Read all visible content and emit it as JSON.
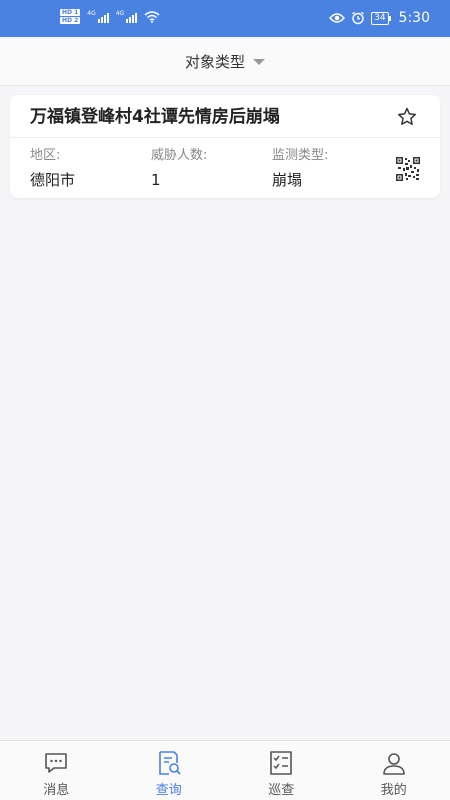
{
  "status_bar": {
    "hd1": "HD 1",
    "hd2": "HD 2",
    "net1": "4G",
    "net2": "4G",
    "battery": "34",
    "time": "5:30"
  },
  "filter": {
    "label": "对象类型"
  },
  "card": {
    "title": "万福镇登峰村4社谭先情房后崩塌",
    "fields": [
      {
        "label": "地区:",
        "value": "德阳市"
      },
      {
        "label": "威胁人数:",
        "value": "1"
      },
      {
        "label": "监测类型:",
        "value": "崩塌"
      }
    ]
  },
  "nav": {
    "items": [
      {
        "label": "消息",
        "icon": "message-icon"
      },
      {
        "label": "查询",
        "icon": "query-icon"
      },
      {
        "label": "巡查",
        "icon": "patrol-icon"
      },
      {
        "label": "我的",
        "icon": "user-icon"
      }
    ],
    "active_index": 1
  },
  "colors": {
    "accent": "#4a82e2",
    "status_bar": "#4a82e2",
    "background": "#f5f5f7",
    "inactive": "#555555"
  }
}
